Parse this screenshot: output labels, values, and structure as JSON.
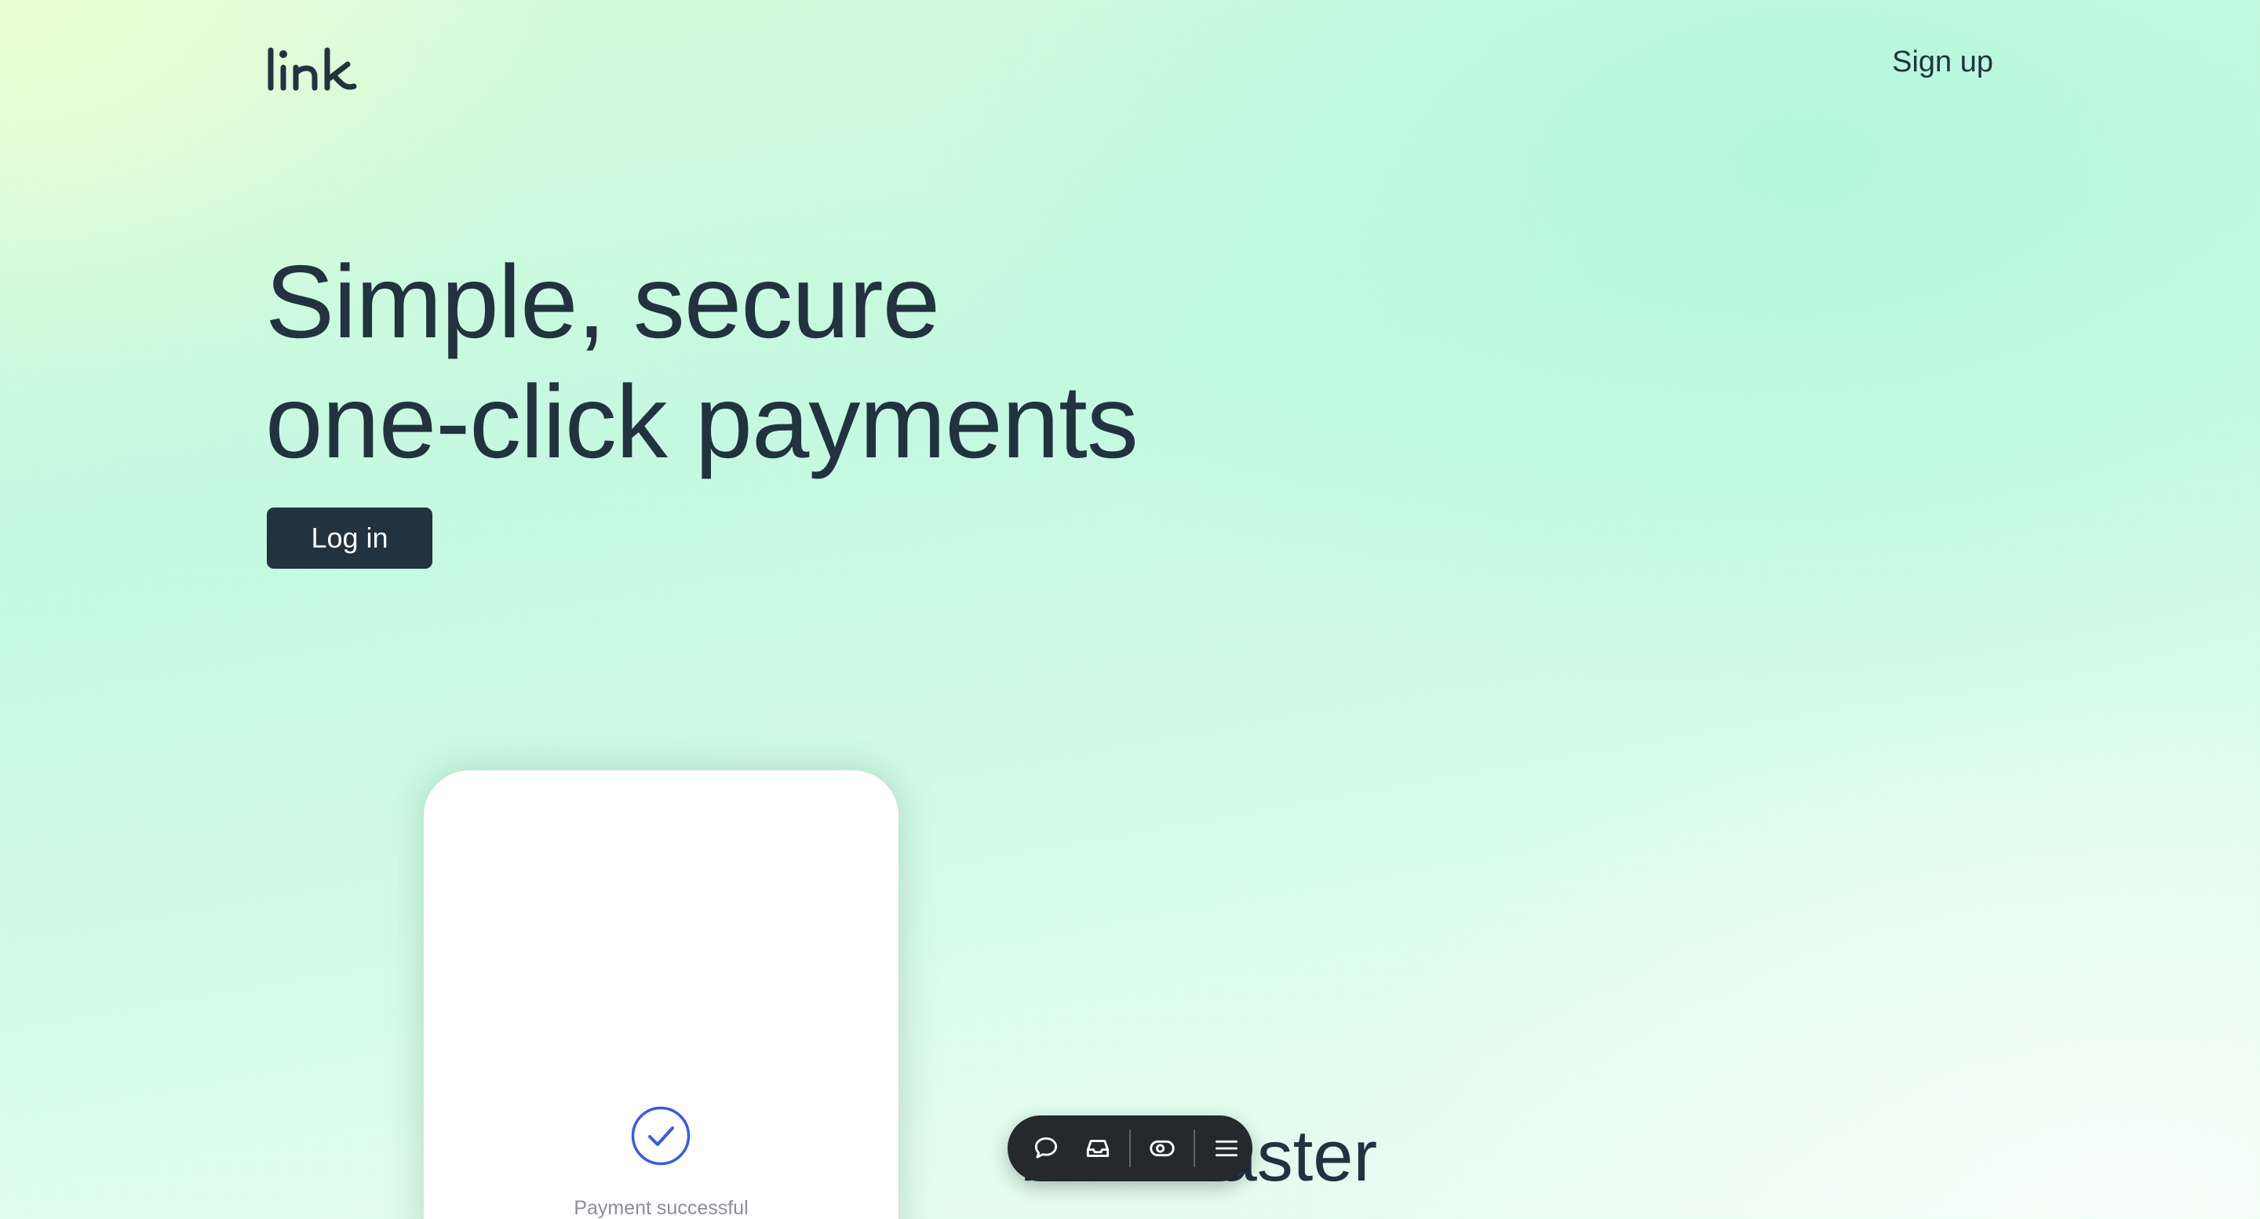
{
  "header": {
    "logo_text": "link",
    "signup_label": "Sign up"
  },
  "hero": {
    "title_line_1": "Simple, secure",
    "title_line_2": "one-click payments",
    "login_label": "Log in"
  },
  "phone": {
    "status_text": "Payment successful",
    "status_icon": "check-circle-icon",
    "accent_color": "#3b5bdb"
  },
  "section": {
    "heading_visible": "k out faster"
  },
  "toolbar": {
    "icons": [
      "comment-icon",
      "inbox-icon",
      "eye-icon",
      "menu-icon"
    ]
  },
  "colors": {
    "text": "#22323f",
    "button_bg": "#22323f",
    "toolbar_bg": "#24292c"
  }
}
